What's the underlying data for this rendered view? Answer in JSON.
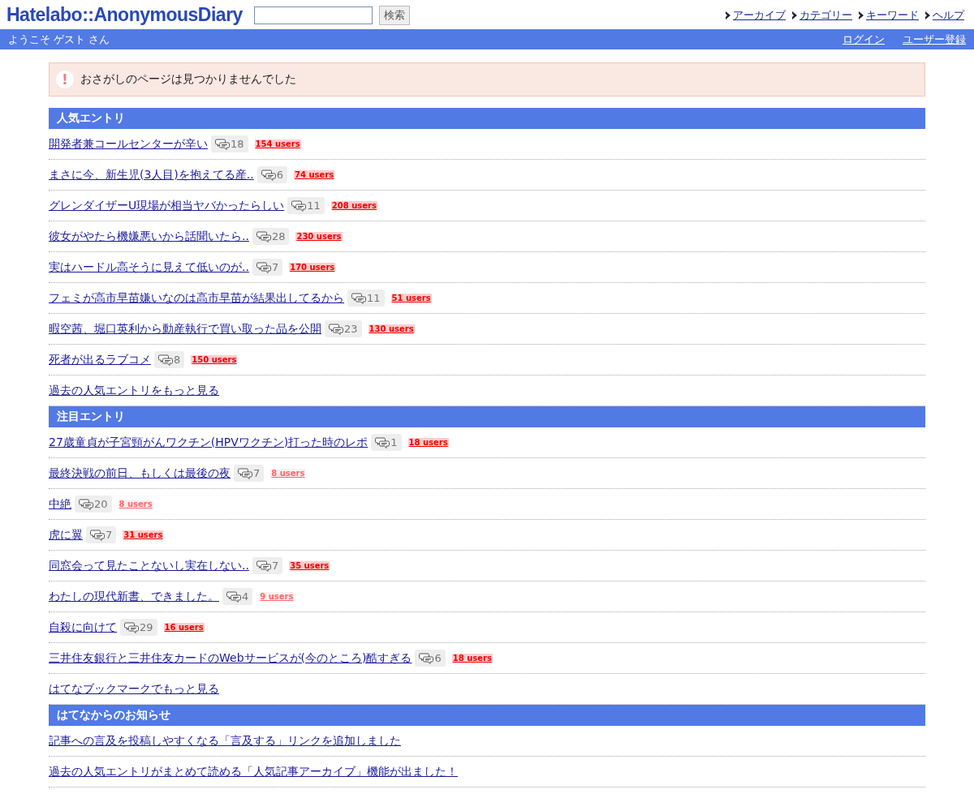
{
  "header": {
    "logo": "Hatelabo::AnonymousDiary",
    "search": {
      "button": "検索"
    },
    "nav": [
      "アーカイブ",
      "カテゴリー",
      "キーワード",
      "ヘルプ"
    ]
  },
  "userbar": {
    "welcome": "ようこそ ゲスト さん",
    "links": [
      "ログイン",
      "ユーザー登録"
    ]
  },
  "alert": {
    "icon": "!",
    "message": "おさがしのページは見つかりませんでした"
  },
  "sections": [
    {
      "title": "人気エントリ",
      "entries": [
        {
          "title": "開発者兼コールセンターが辛い",
          "comments": "18",
          "users": "154 users",
          "faded": false
        },
        {
          "title": "まさに今、新生児(3人目)を抱えてる産..",
          "comments": "6",
          "users": "74 users",
          "faded": false
        },
        {
          "title": "グレンダイザーU現場が相当ヤバかったらしい",
          "comments": "11",
          "users": "208 users",
          "faded": false
        },
        {
          "title": "彼女がやたら機嫌悪いから話聞いたら..",
          "comments": "28",
          "users": "230 users",
          "faded": false
        },
        {
          "title": "実はハードル高そうに見えて低いのが..",
          "comments": "7",
          "users": "170 users",
          "faded": false
        },
        {
          "title": "フェミが高市早苗嫌いなのは高市早苗が結果出してるから",
          "comments": "11",
          "users": "51 users",
          "faded": false
        },
        {
          "title": "暇空茜、堀口英利から動産執行で買い取った品を公開",
          "comments": "23",
          "users": "130 users",
          "faded": false
        },
        {
          "title": "死者が出るラブコメ",
          "comments": "8",
          "users": "150 users",
          "faded": false
        }
      ],
      "more": "過去の人気エントリをもっと見る"
    },
    {
      "title": "注目エントリ",
      "entries": [
        {
          "title": "27歳童貞が子宮頸がんワクチン(HPVワクチン)打った時のレポ",
          "comments": "1",
          "users": "18 users",
          "faded": false
        },
        {
          "title": "最終決戦の前日、もしくは最後の夜",
          "comments": "7",
          "users": "8 users",
          "faded": true
        },
        {
          "title": "中絶",
          "comments": "20",
          "users": "8 users",
          "faded": true
        },
        {
          "title": "虎に翼",
          "comments": "7",
          "users": "31 users",
          "faded": false
        },
        {
          "title": "同窓会って見たことないし実在しない..",
          "comments": "7",
          "users": "35 users",
          "faded": false
        },
        {
          "title": "わたしの現代新書、できました。 ",
          "comments": "4",
          "users": "9 users",
          "faded": true
        },
        {
          "title": "自殺に向けて",
          "comments": "29",
          "users": "16 users",
          "faded": false
        },
        {
          "title": "三井住友銀行と三井住友カードのWebサービスが(今のところ)酷すぎる",
          "comments": "6",
          "users": "18 users",
          "faded": false
        }
      ],
      "more": "はてなブックマークでもっと見る"
    },
    {
      "title": "はてなからのお知らせ",
      "entries": [
        {
          "title": "記事への言及を投稿しやすくなる「言及する」リンクを追加しました"
        },
        {
          "title": "過去の人気エントリがまとめて読める「人気記事アーカイブ」機能が出ました！"
        }
      ]
    }
  ]
}
